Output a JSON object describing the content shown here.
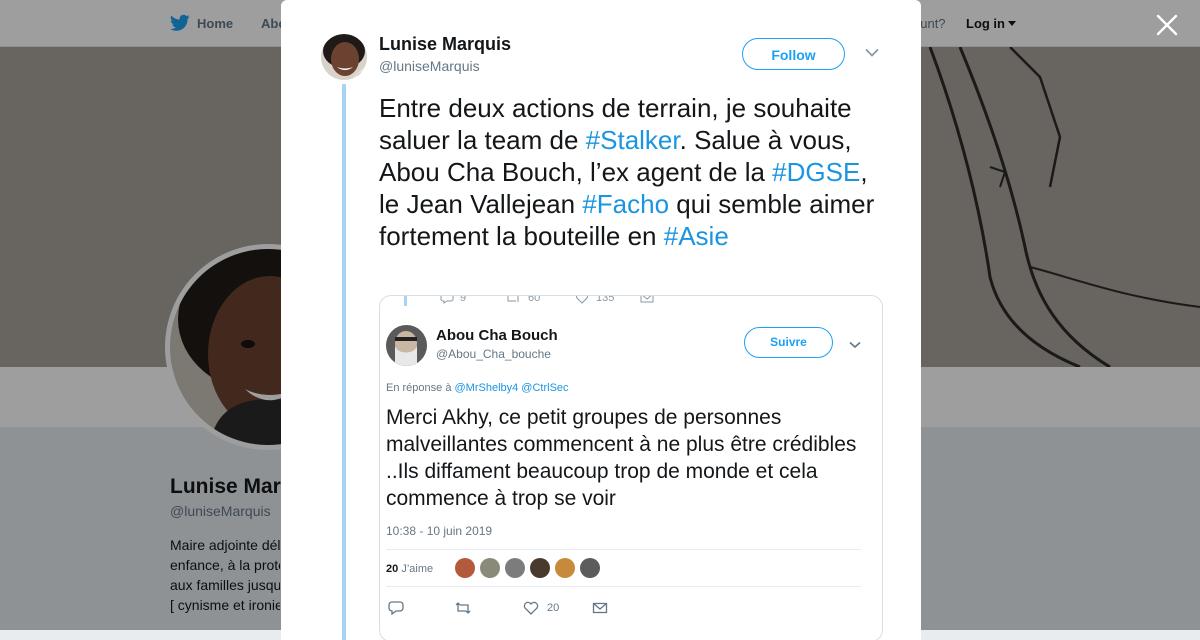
{
  "topbar": {
    "home_label": "Home",
    "about_label": "Abo",
    "account_prompt": "ccount?",
    "login_label": "Log in"
  },
  "profile": {
    "name": "Lunise Mar",
    "handle": "@luniseMarquis",
    "bio_lines": [
      "Maire adjointe dél",
      "enfance, à la prote",
      "aux familles jusqu",
      "[ cynisme et ironie"
    ]
  },
  "tweet": {
    "author_name": "Lunise Marquis",
    "author_handle": "@luniseMarquis",
    "follow_label": "Follow",
    "text_segments": [
      {
        "text": "Entre deux actions de terrain, je souhaite saluer la team de ",
        "hashtag": false
      },
      {
        "text": "#Stalker",
        "hashtag": true
      },
      {
        "text": ". Salue à vous, Abou Cha  Bouch, l’ex agent de la ",
        "hashtag": false
      },
      {
        "text": "#DGSE",
        "hashtag": true
      },
      {
        "text": ", le Jean Vallejean ",
        "hashtag": false
      },
      {
        "text": "#Facho",
        "hashtag": true
      },
      {
        "text": " qui semble aimer fortement la bouteille en ",
        "hashtag": false
      },
      {
        "text": "#Asie",
        "hashtag": true
      }
    ]
  },
  "embedded": {
    "top_counts": [
      "9",
      "60",
      "135"
    ],
    "name": "Abou Cha Bouch",
    "handle": "@Abou_Cha_bouche",
    "follow_label": "Suivre",
    "reply_prefix": "En réponse à ",
    "reply_mentions": "@MrShelby4 @CtrlSec",
    "text": "Merci Akhy, ce petit groupes de personnes malveillantes commencent à ne plus être crédibles ..Ils diffament beaucoup trop de monde et cela commence à trop se voir",
    "datetime": "10:38 - 10 juin 2019",
    "likes_count": "20",
    "likes_label": "J’aime",
    "action_like_count": "20"
  },
  "colors": {
    "accent": "#1da1f2",
    "hashtag": "#1b95e0",
    "thread_line": "#a6d4f2",
    "text": "#14171a",
    "muted": "#657786"
  }
}
